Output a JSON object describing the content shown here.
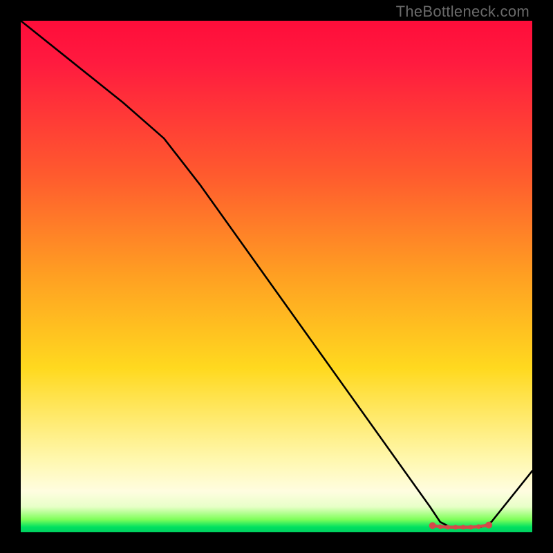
{
  "watermark": "TheBottleneck.com",
  "chart_data": {
    "type": "line",
    "title": "",
    "xlabel": "",
    "ylabel": "",
    "xlim": [
      0,
      100
    ],
    "ylim": [
      0,
      100
    ],
    "grid": false,
    "legend": false,
    "series": [
      {
        "name": "curve",
        "x": [
          0,
          10,
          20,
          28,
          35,
          45,
          55,
          65,
          75,
          80,
          82,
          84,
          86,
          88,
          90,
          92,
          100
        ],
        "y": [
          100,
          92,
          84,
          77,
          68,
          54,
          40,
          26,
          12,
          5,
          2,
          1,
          1,
          1,
          1,
          2,
          12
        ]
      }
    ],
    "markers": {
      "name": "bottom-dots",
      "color": "#d44a4a",
      "x": [
        80.5,
        82,
        83.5,
        85,
        86.5,
        88,
        89.5,
        91.5
      ],
      "y": [
        1.3,
        1.1,
        1.0,
        1.0,
        1.0,
        1.0,
        1.1,
        1.4
      ]
    },
    "background_gradient": {
      "top": "#ff0d3a",
      "mid_upper": "#ffa022",
      "mid_lower": "#fff8b0",
      "bottom": "#00d060"
    }
  }
}
